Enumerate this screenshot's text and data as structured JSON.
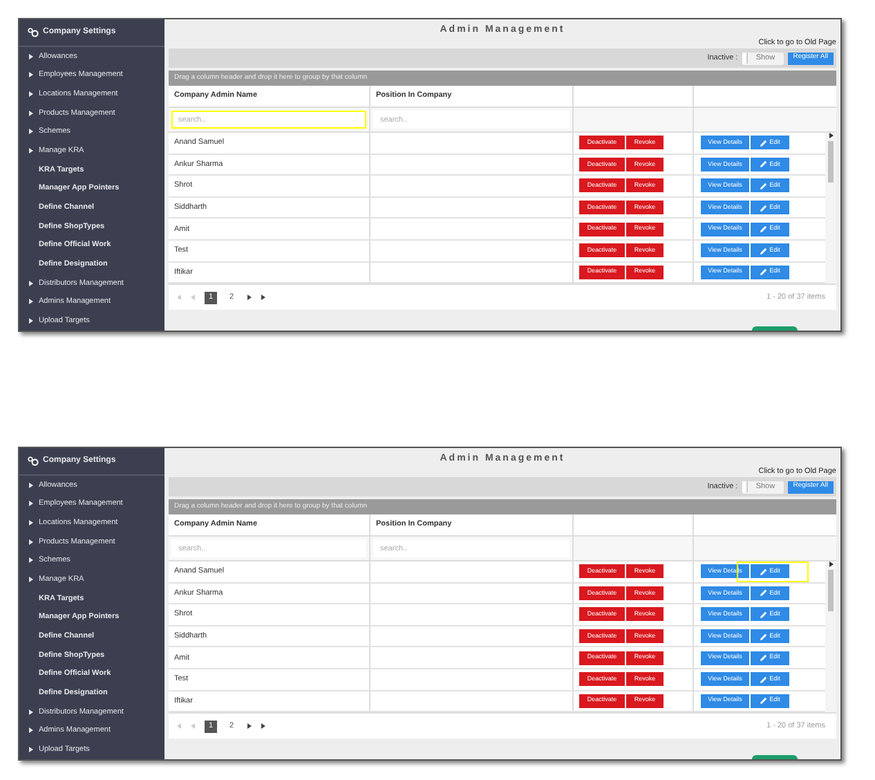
{
  "screenshots": [
    {
      "sidebar": {
        "title": "Company Settings",
        "items": [
          {
            "label": "Allowances",
            "kind": "group"
          },
          {
            "label": "Employees Management",
            "kind": "group"
          },
          {
            "label": "Locations Management",
            "kind": "group"
          },
          {
            "label": "Products Management",
            "kind": "group"
          },
          {
            "label": "Schemes",
            "kind": "group"
          },
          {
            "label": "Manage KRA",
            "kind": "group"
          },
          {
            "label": "KRA Targets",
            "kind": "link"
          },
          {
            "label": "Manager App Pointers",
            "kind": "link"
          },
          {
            "label": "Define Channel",
            "kind": "link"
          },
          {
            "label": "Define ShopTypes",
            "kind": "link"
          },
          {
            "label": "Define Official Work",
            "kind": "link"
          },
          {
            "label": "Define Designation",
            "kind": "link"
          },
          {
            "label": "Distributors Management",
            "kind": "group"
          },
          {
            "label": "Admins Management",
            "kind": "group"
          },
          {
            "label": "Upload Targets",
            "kind": "group"
          }
        ]
      },
      "title": "Admin Management",
      "old_page_link": "Click to go to Old Page",
      "toolbar": {
        "inactive_label": "Inactive :",
        "toggle": {
          "label": "Show",
          "on": false
        },
        "register_button": "Register All"
      },
      "group_hint": "Drag a column header and drop it here to group by that column",
      "columns": [
        "Company Admin Name",
        "Position In Company"
      ],
      "filters": [
        {
          "placeholder": "search..",
          "highlighted": true
        },
        {
          "placeholder": "search..",
          "highlighted": false
        }
      ],
      "rows": [
        {
          "name": "Anand Samuel",
          "deactivate": "Deactivate",
          "revoke": "Revoke",
          "view": "View Details",
          "edit": "Edit",
          "edit_highlighted": false
        },
        {
          "name": "Ankur Sharma",
          "deactivate": "Deactivate",
          "revoke": "Revoke",
          "view": "View Details",
          "edit": "Edit",
          "edit_highlighted": false
        },
        {
          "name": "Shrot",
          "deactivate": "Deactivate",
          "revoke": "Revoke",
          "view": "View Details",
          "edit": "Edit",
          "edit_highlighted": false
        },
        {
          "name": "Siddharth",
          "deactivate": "Deactivate",
          "revoke": "Revoke",
          "view": "View Details",
          "edit": "Edit",
          "edit_highlighted": false
        },
        {
          "name": "Amit",
          "deactivate": "Deactivate",
          "revoke": "Revoke",
          "view": "View Details",
          "edit": "Edit",
          "edit_highlighted": false
        },
        {
          "name": "Test",
          "deactivate": "Deactivate",
          "revoke": "Revoke",
          "view": "View Details",
          "edit": "Edit",
          "edit_highlighted": false
        },
        {
          "name": "Iftikar",
          "deactivate": "Deactivate",
          "revoke": "Revoke",
          "view": "View Details",
          "edit": "Edit",
          "edit_highlighted": false
        }
      ],
      "pager": {
        "pages": [
          {
            "label": "1",
            "selected": true
          },
          {
            "label": "2",
            "selected": false
          }
        ],
        "summary": "1 - 20 of 37 items"
      }
    },
    {
      "sidebar": {
        "title": "Company Settings",
        "items": [
          {
            "label": "Allowances",
            "kind": "group"
          },
          {
            "label": "Employees Management",
            "kind": "group"
          },
          {
            "label": "Locations Management",
            "kind": "group"
          },
          {
            "label": "Products Management",
            "kind": "group"
          },
          {
            "label": "Schemes",
            "kind": "group"
          },
          {
            "label": "Manage KRA",
            "kind": "group"
          },
          {
            "label": "KRA Targets",
            "kind": "link"
          },
          {
            "label": "Manager App Pointers",
            "kind": "link"
          },
          {
            "label": "Define Channel",
            "kind": "link"
          },
          {
            "label": "Define ShopTypes",
            "kind": "link"
          },
          {
            "label": "Define Official Work",
            "kind": "link"
          },
          {
            "label": "Define Designation",
            "kind": "link"
          },
          {
            "label": "Distributors Management",
            "kind": "group"
          },
          {
            "label": "Admins Management",
            "kind": "group"
          },
          {
            "label": "Upload Targets",
            "kind": "group"
          }
        ]
      },
      "title": "Admin Management",
      "old_page_link": "Click to go to Old Page",
      "toolbar": {
        "inactive_label": "Inactive :",
        "toggle": {
          "label": "Show",
          "on": false
        },
        "register_button": "Register All"
      },
      "group_hint": "Drag a column header and drop it here to group by that column",
      "columns": [
        "Company Admin Name",
        "Position In Company"
      ],
      "filters": [
        {
          "placeholder": "search..",
          "highlighted": false
        },
        {
          "placeholder": "search..",
          "highlighted": false
        }
      ],
      "rows": [
        {
          "name": "Anand Samuel",
          "deactivate": "Deactivate",
          "revoke": "Revoke",
          "view": "View Details",
          "edit": "Edit",
          "edit_highlighted": true
        },
        {
          "name": "Ankur Sharma",
          "deactivate": "Deactivate",
          "revoke": "Revoke",
          "view": "View Details",
          "edit": "Edit",
          "edit_highlighted": false
        },
        {
          "name": "Shrot",
          "deactivate": "Deactivate",
          "revoke": "Revoke",
          "view": "View Details",
          "edit": "Edit",
          "edit_highlighted": false
        },
        {
          "name": "Siddharth",
          "deactivate": "Deactivate",
          "revoke": "Revoke",
          "view": "View Details",
          "edit": "Edit",
          "edit_highlighted": false
        },
        {
          "name": "Amit",
          "deactivate": "Deactivate",
          "revoke": "Revoke",
          "view": "View Details",
          "edit": "Edit",
          "edit_highlighted": false
        },
        {
          "name": "Test",
          "deactivate": "Deactivate",
          "revoke": "Revoke",
          "view": "View Details",
          "edit": "Edit",
          "edit_highlighted": false
        },
        {
          "name": "Iftikar",
          "deactivate": "Deactivate",
          "revoke": "Revoke",
          "view": "View Details",
          "edit": "Edit",
          "edit_highlighted": false
        }
      ],
      "pager": {
        "pages": [
          {
            "label": "1",
            "selected": true
          },
          {
            "label": "2",
            "selected": false
          }
        ],
        "summary": "1 - 20 of 37 items"
      }
    }
  ]
}
